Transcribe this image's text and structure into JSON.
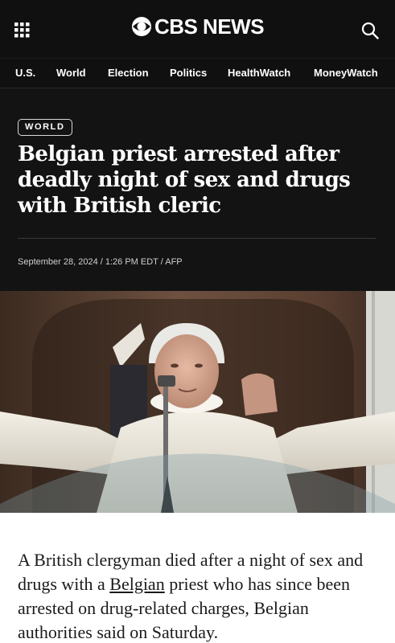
{
  "header": {
    "logo_text": "CBS NEWS",
    "menu_icon": "grid-menu-icon",
    "search_icon": "search-icon"
  },
  "nav": {
    "items": [
      {
        "label": "U.S."
      },
      {
        "label": "World"
      },
      {
        "label": "Election"
      },
      {
        "label": "Politics"
      },
      {
        "label": "HealthWatch"
      },
      {
        "label": "MoneyWatch"
      }
    ]
  },
  "article": {
    "category": "WORLD",
    "headline": "Belgian priest arrested after deadly night of sex and drugs with British cleric",
    "dateline": "September 28, 2024 / 1:26 PM EDT / AFP",
    "body_before_link": "A British clergyman died after a night of sex and drugs with a ",
    "body_link": "Belgian",
    "body_after_link": " priest who has since been arrested on drug-related charges, Belgian authorities said on Saturday."
  },
  "colors": {
    "header_bg": "#101010",
    "hero_bg": "#131313",
    "text_light": "#ffffff",
    "body_bg": "#ffffff",
    "body_text": "#1a1a1a"
  }
}
